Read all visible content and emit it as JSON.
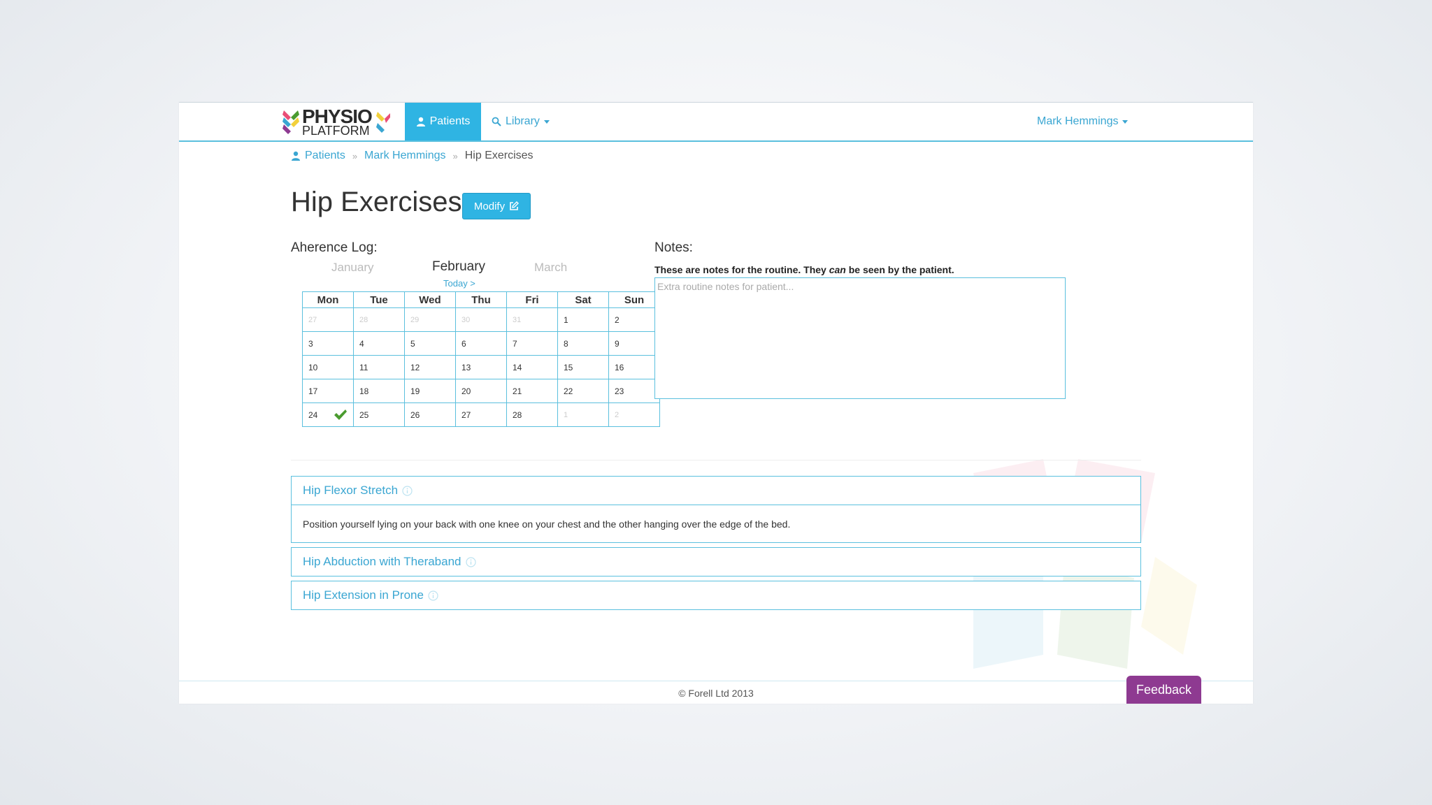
{
  "brand": {
    "line1": "PHYSIO",
    "line2": "PLATFORM"
  },
  "nav": {
    "patients": "Patients",
    "library": "Library",
    "user": "Mark Hemmings"
  },
  "breadcrumb": {
    "patients": "Patients",
    "patient": "Mark Hemmings",
    "current": "Hip Exercises"
  },
  "page": {
    "title": "Hip Exercises",
    "modify": "Modify"
  },
  "adherence": {
    "label": "Aherence Log:",
    "prev_month": "January",
    "current_month": "February",
    "next_month": "March",
    "today": "Today >",
    "weekdays": [
      "Mon",
      "Tue",
      "Wed",
      "Thu",
      "Fri",
      "Sat",
      "Sun"
    ],
    "weeks": [
      [
        {
          "d": "27",
          "m": true
        },
        {
          "d": "28",
          "m": true
        },
        {
          "d": "29",
          "m": true
        },
        {
          "d": "30",
          "m": true
        },
        {
          "d": "31",
          "m": true
        },
        {
          "d": "1"
        },
        {
          "d": "2"
        }
      ],
      [
        {
          "d": "3"
        },
        {
          "d": "4"
        },
        {
          "d": "5"
        },
        {
          "d": "6"
        },
        {
          "d": "7"
        },
        {
          "d": "8"
        },
        {
          "d": "9"
        }
      ],
      [
        {
          "d": "10"
        },
        {
          "d": "11"
        },
        {
          "d": "12"
        },
        {
          "d": "13"
        },
        {
          "d": "14"
        },
        {
          "d": "15"
        },
        {
          "d": "16"
        }
      ],
      [
        {
          "d": "17"
        },
        {
          "d": "18"
        },
        {
          "d": "19"
        },
        {
          "d": "20"
        },
        {
          "d": "21"
        },
        {
          "d": "22"
        },
        {
          "d": "23"
        }
      ],
      [
        {
          "d": "24",
          "done": true
        },
        {
          "d": "25"
        },
        {
          "d": "26"
        },
        {
          "d": "27"
        },
        {
          "d": "28"
        },
        {
          "d": "1",
          "m": true
        },
        {
          "d": "2",
          "m": true
        }
      ]
    ]
  },
  "notes": {
    "label": "Notes:",
    "desc_before": "These are notes for the routine. They ",
    "desc_em": "can",
    "desc_after": " be seen by the patient.",
    "placeholder": "Extra routine notes for patient..."
  },
  "exercises": [
    {
      "name": "Hip Flexor Stretch",
      "expanded": true,
      "description": "Position yourself lying on your back with one knee on your chest and the other hanging over the edge of the bed."
    },
    {
      "name": "Hip Abduction with Theraband",
      "expanded": false
    },
    {
      "name": "Hip Extension in Prone",
      "expanded": false
    }
  ],
  "footer": {
    "copyright": "© Forell Ltd 2013",
    "feedback": "Feedback"
  },
  "colors": {
    "accent": "#2fb4e3",
    "link": "#3aa6d2",
    "border": "#5bc0de",
    "check": "#4a9b2f",
    "feedback": "#8e3a91"
  }
}
